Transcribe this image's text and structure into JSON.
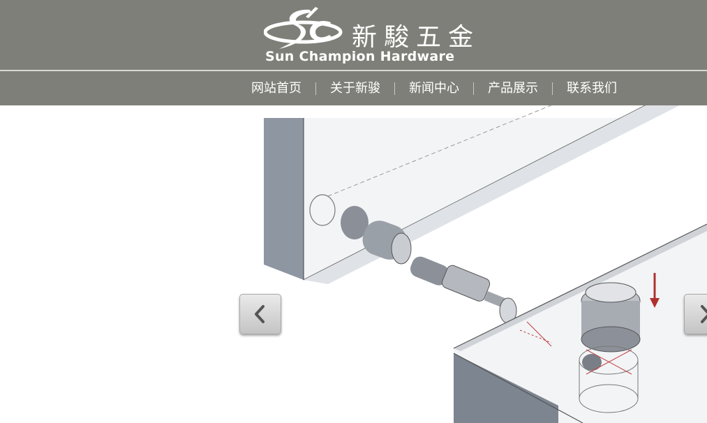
{
  "brand": {
    "chinese_name": "新駿五金",
    "english_name": "Sun Champion Hardware",
    "logo_monogram": "SC"
  },
  "nav": {
    "items": [
      {
        "label": "网站首页"
      },
      {
        "label": "关于新骏"
      },
      {
        "label": "新闻中心"
      },
      {
        "label": "产品展示"
      },
      {
        "label": "联系我们"
      }
    ]
  },
  "slider": {
    "image": "cam-lock-connector-assembly-illustration",
    "prev_icon": "chevron-left-icon",
    "next_icon": "chevron-right-icon"
  },
  "colors": {
    "header_bg": "#7f7f79",
    "nav_text": "#ffffff",
    "accent_red": "#b03030"
  }
}
